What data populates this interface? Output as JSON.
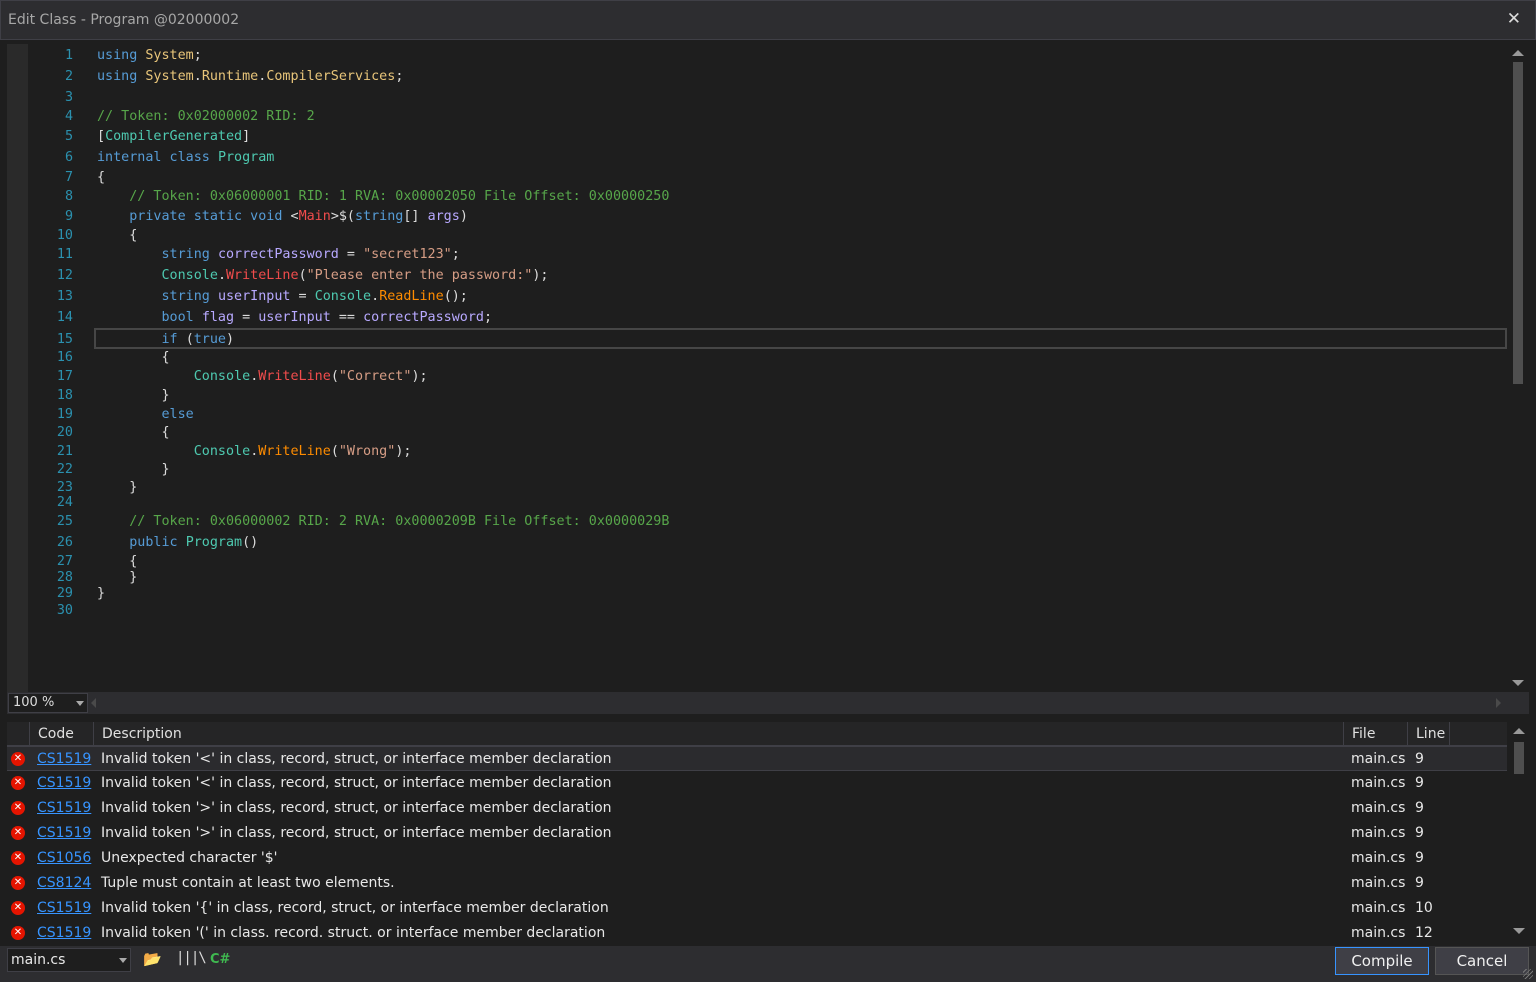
{
  "window": {
    "title": "Edit Class - Program @02000002",
    "close": "✕"
  },
  "editor": {
    "lines": [
      {
        "n": "1",
        "t": [
          [
            "kw",
            "using "
          ],
          [
            "ty",
            "System"
          ],
          [
            "pl",
            ";"
          ]
        ]
      },
      {
        "n": "2",
        "t": [
          [
            "kw",
            "using "
          ],
          [
            "ty",
            "System"
          ],
          [
            "pl",
            "."
          ],
          [
            "ty",
            "Runtime"
          ],
          [
            "pl",
            "."
          ],
          [
            "ty",
            "CompilerServices"
          ],
          [
            "pl",
            ";"
          ]
        ]
      },
      {
        "n": "3",
        "t": []
      },
      {
        "n": "4",
        "t": [
          [
            "cm",
            "// Token: 0x02000002 RID: 2"
          ]
        ]
      },
      {
        "n": "5",
        "t": [
          [
            "pl",
            "["
          ],
          [
            "tp",
            "CompilerGenerated"
          ],
          [
            "pl",
            "]"
          ]
        ]
      },
      {
        "n": "6",
        "t": [
          [
            "kw",
            "internal class "
          ],
          [
            "tp",
            "Program"
          ]
        ]
      },
      {
        "n": "7",
        "t": [
          [
            "pl",
            "{"
          ]
        ]
      },
      {
        "n": "8",
        "t": [
          [
            "pl",
            "    "
          ],
          [
            "cm",
            "// Token: 0x06000001 RID: 1 RVA: 0x00002050 File Offset: 0x00000250"
          ]
        ]
      },
      {
        "n": "9",
        "t": [
          [
            "pl",
            "    "
          ],
          [
            "kw",
            "private static void "
          ],
          [
            "pl",
            "<"
          ],
          [
            "mt",
            "Main"
          ],
          [
            "pl",
            ">$("
          ],
          [
            "kw",
            "string"
          ],
          [
            "pl",
            "[] "
          ],
          [
            "pm",
            "args"
          ],
          [
            "pl",
            ")"
          ]
        ]
      },
      {
        "n": "10",
        "t": [
          [
            "pl",
            "    {"
          ]
        ]
      },
      {
        "n": "11",
        "t": [
          [
            "pl",
            "        "
          ],
          [
            "kw",
            "string "
          ],
          [
            "pm",
            "correctPassword"
          ],
          [
            "pl",
            " = "
          ],
          [
            "st",
            "\"secret123\""
          ],
          [
            "pl",
            ";"
          ]
        ]
      },
      {
        "n": "12",
        "t": [
          [
            "pl",
            "        "
          ],
          [
            "tp",
            "Console"
          ],
          [
            "pl",
            "."
          ],
          [
            "mt",
            "WriteLine"
          ],
          [
            "pl",
            "("
          ],
          [
            "st",
            "\"Please enter the password:\""
          ],
          [
            "pl",
            ");"
          ]
        ]
      },
      {
        "n": "13",
        "t": [
          [
            "pl",
            "        "
          ],
          [
            "kw",
            "string "
          ],
          [
            "pm",
            "userInput"
          ],
          [
            "pl",
            " = "
          ],
          [
            "tp",
            "Console"
          ],
          [
            "pl",
            "."
          ],
          [
            "mo",
            "ReadLine"
          ],
          [
            "pl",
            "();"
          ]
        ]
      },
      {
        "n": "14",
        "t": [
          [
            "pl",
            "        "
          ],
          [
            "kw",
            "bool "
          ],
          [
            "pm",
            "flag"
          ],
          [
            "pl",
            " = "
          ],
          [
            "pm",
            "userInput"
          ],
          [
            "pl",
            " == "
          ],
          [
            "pm",
            "correctPassword"
          ],
          [
            "pl",
            ";"
          ]
        ]
      },
      {
        "n": "15",
        "t": [
          [
            "pl",
            "        "
          ],
          [
            "kw",
            "if "
          ],
          [
            "pl",
            "("
          ],
          [
            "kw",
            "true"
          ],
          [
            "pl",
            ")"
          ]
        ]
      },
      {
        "n": "16",
        "t": [
          [
            "pl",
            "        {"
          ]
        ]
      },
      {
        "n": "17",
        "t": [
          [
            "pl",
            "            "
          ],
          [
            "tp",
            "Console"
          ],
          [
            "pl",
            "."
          ],
          [
            "mt",
            "WriteLine"
          ],
          [
            "pl",
            "("
          ],
          [
            "st",
            "\"Correct\""
          ],
          [
            "pl",
            ");"
          ]
        ]
      },
      {
        "n": "18",
        "t": [
          [
            "pl",
            "        }"
          ]
        ]
      },
      {
        "n": "19",
        "t": [
          [
            "pl",
            "        "
          ],
          [
            "kw",
            "else"
          ]
        ]
      },
      {
        "n": "20",
        "t": [
          [
            "pl",
            "        {"
          ]
        ]
      },
      {
        "n": "21",
        "t": [
          [
            "pl",
            "            "
          ],
          [
            "tp",
            "Console"
          ],
          [
            "pl",
            "."
          ],
          [
            "mo",
            "WriteLine"
          ],
          [
            "pl",
            "("
          ],
          [
            "st",
            "\"Wrong\""
          ],
          [
            "pl",
            ");"
          ]
        ]
      },
      {
        "n": "22",
        "t": [
          [
            "pl",
            "        }"
          ]
        ]
      },
      {
        "n": "23",
        "t": [
          [
            "pl",
            "    }"
          ]
        ]
      },
      {
        "n": "24",
        "t": []
      },
      {
        "n": "25",
        "t": [
          [
            "pl",
            "    "
          ],
          [
            "cm",
            "// Token: 0x06000002 RID: 2 RVA: 0x0000209B File Offset: 0x0000029B"
          ]
        ]
      },
      {
        "n": "26",
        "t": [
          [
            "pl",
            "    "
          ],
          [
            "kw",
            "public "
          ],
          [
            "tp",
            "Program"
          ],
          [
            "pl",
            "()"
          ]
        ]
      },
      {
        "n": "27",
        "t": [
          [
            "pl",
            "    {"
          ]
        ]
      },
      {
        "n": "28",
        "t": [
          [
            "pl",
            "    }"
          ]
        ]
      },
      {
        "n": "29",
        "t": [
          [
            "pl",
            "}"
          ]
        ]
      },
      {
        "n": "30",
        "t": []
      }
    ],
    "line_tops": [
      0,
      21,
      42,
      61,
      81,
      102,
      122,
      141,
      161,
      180,
      199,
      220,
      241,
      262,
      284,
      302,
      321,
      340,
      359,
      377,
      396,
      414,
      432,
      447,
      466,
      487,
      506,
      522,
      538,
      555
    ]
  },
  "zoom": {
    "value": "100 %"
  },
  "errors": {
    "headers": {
      "code": "Code",
      "description": "Description",
      "file": "File",
      "line": "Line"
    },
    "rows": [
      {
        "code": "CS1519",
        "desc": "Invalid token '<' in class, record, struct, or interface member declaration",
        "file": "main.cs",
        "line": "9"
      },
      {
        "code": "CS1519",
        "desc": "Invalid token '<' in class, record, struct, or interface member declaration",
        "file": "main.cs",
        "line": "9"
      },
      {
        "code": "CS1519",
        "desc": "Invalid token '>' in class, record, struct, or interface member declaration",
        "file": "main.cs",
        "line": "9"
      },
      {
        "code": "CS1519",
        "desc": "Invalid token '>' in class, record, struct, or interface member declaration",
        "file": "main.cs",
        "line": "9"
      },
      {
        "code": "CS1056",
        "desc": "Unexpected character '$'",
        "file": "main.cs",
        "line": "9"
      },
      {
        "code": "CS8124",
        "desc": "Tuple must contain at least two elements.",
        "file": "main.cs",
        "line": "9"
      },
      {
        "code": "CS1519",
        "desc": "Invalid token '{' in class, record, struct, or interface member declaration",
        "file": "main.cs",
        "line": "10"
      },
      {
        "code": "CS1519",
        "desc": "Invalid token '(' in class. record. struct. or interface member declaration",
        "file": "main.cs",
        "line": "12"
      }
    ]
  },
  "footer": {
    "file": "main.cs",
    "cs_label": "C#",
    "compile": "Compile",
    "cancel": "Cancel"
  },
  "icons": [
    "close-icon",
    "error-icon",
    "open-folder-icon",
    "library-icon",
    "csharp-icon",
    "chevron-down-icon"
  ]
}
